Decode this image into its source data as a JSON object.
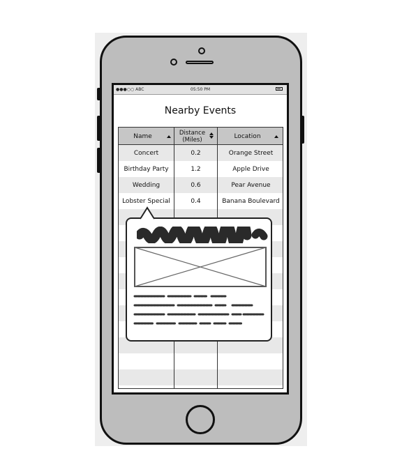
{
  "status_bar": {
    "carrier": "●●●○○ ABC",
    "time": "05:50 PM",
    "battery_icon": "battery-icon"
  },
  "page": {
    "title": "Nearby Events"
  },
  "table": {
    "columns": [
      {
        "label": "Name",
        "sort": "sort-asc-icon"
      },
      {
        "label": "Distance (Miles)",
        "sort": "sort-both-icon"
      },
      {
        "label": "Location",
        "sort": "sort-asc-icon"
      }
    ],
    "rows": [
      {
        "name": "Concert",
        "distance": "0.2",
        "location": "Orange Street"
      },
      {
        "name": "Birthday Party",
        "distance": "1.2",
        "location": "Apple Drive"
      },
      {
        "name": "Wedding",
        "distance": "0.6",
        "location": "Pear Avenue"
      },
      {
        "name": "Lobster Special",
        "distance": "0.4",
        "location": "Banana Boulevard"
      }
    ]
  },
  "popover": {
    "heading_icon": "scribbled-heading",
    "image_icon": "image-placeholder-icon",
    "body_icon": "scribbled-text-lines"
  },
  "colors": {
    "device": "#bdbdbd",
    "header": "#c6c6c6",
    "stripe": "#e8e8e8",
    "ink": "#111111"
  }
}
